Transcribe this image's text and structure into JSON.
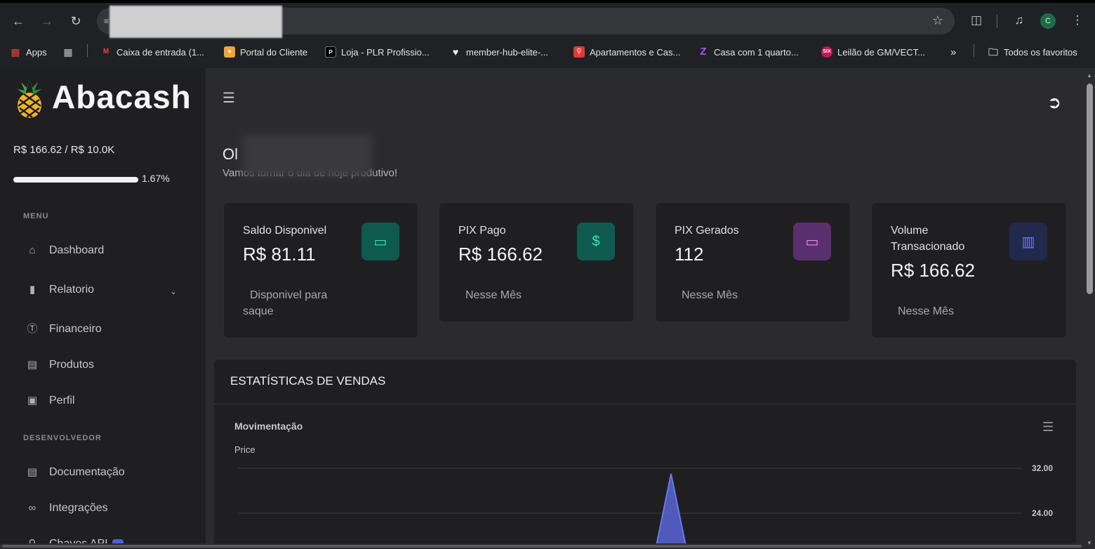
{
  "browser": {
    "bookmarks": [
      {
        "label": "Apps",
        "color": "#e8453c"
      },
      {
        "label": "",
        "color": "#5f6368"
      },
      {
        "label": "Caixa de entrada (1...",
        "color": "#ea4335"
      },
      {
        "label": "Portal do Cliente",
        "color": "#f2a33a"
      },
      {
        "label": "Loja - PLR Profissio...",
        "color": "#000000"
      },
      {
        "label": "member-hub-elite-...",
        "color": "#ffffff"
      },
      {
        "label": "Apartamentos e Cas...",
        "color": "#e53935"
      },
      {
        "label": "Casa com 1 quarto...",
        "color": "#7b3fe4"
      },
      {
        "label": "Leilão de GM/VECT...",
        "color": "#c2185b"
      }
    ],
    "more_bookmarks": "»",
    "all_favorites": "Todos os favoritos",
    "avatar_letter": "C"
  },
  "sidebar": {
    "brand": "Abacash",
    "balance_text": "R$ 166.62 / R$ 10.0K",
    "progress_label": "1.67%",
    "progress_fraction": 0.0167,
    "sections": [
      {
        "label": "MENU"
      },
      {
        "label": "DESENVOLVEDOR"
      }
    ],
    "items": [
      {
        "label": "Dashboard",
        "icon": "home-icon"
      },
      {
        "label": "Relatorio",
        "icon": "chart-icon"
      },
      {
        "label": "Financeiro",
        "icon": "dollar-icon"
      },
      {
        "label": "Produtos",
        "icon": "product-icon"
      },
      {
        "label": "Perfil",
        "icon": "profile-icon"
      },
      {
        "label": "Documentação",
        "icon": "document-icon"
      },
      {
        "label": "Integrações",
        "icon": "integration-icon"
      },
      {
        "label": "Chaves API",
        "icon": "key-icon"
      }
    ]
  },
  "main": {
    "greeting": "Ol",
    "greeting_sub": "Vamos tornar o dia de hoje produtivo!",
    "cards": [
      {
        "title": "Saldo Disponivel",
        "value": "R$ 81.11",
        "sub": "Disponivel para saque",
        "icon": "wallet-icon",
        "icon_bg": "#0f5a4e",
        "icon_color": "#2ee8b6"
      },
      {
        "title": "PIX Pago",
        "value": "R$ 166.62",
        "sub": "Nesse Mês",
        "icon": "dollar-icon",
        "icon_bg": "#0f5a4e",
        "icon_color": "#2ee8b6"
      },
      {
        "title": "PIX Gerados",
        "value": "112",
        "sub": "Nesse Mês",
        "icon": "wallet-icon",
        "icon_bg": "#5a2f6e",
        "icon_color": "#e58bf5"
      },
      {
        "title": "Volume Transacionado",
        "value": "R$ 166.62",
        "sub": "Nesse Mês",
        "icon": "bar-chart-icon",
        "icon_bg": "#23284d",
        "icon_color": "#6f7de8"
      }
    ],
    "stats_title": "ESTATÍSTICAS DE VENDAS",
    "chart_title": "Movimentação",
    "chart_ylabel": "Price"
  },
  "chart_data": {
    "type": "area",
    "title": "Movimentação",
    "ylabel": "Price",
    "xlabel": "",
    "y_ticks": [
      "32.00",
      "24.00"
    ],
    "ylim_visible": [
      20,
      34
    ],
    "series": [
      {
        "values": [
          0,
          0,
          0,
          0,
          0,
          0,
          0,
          0,
          31,
          0,
          0,
          0,
          0,
          0,
          0,
          0,
          0,
          0,
          0,
          0
        ],
        "color": "#5865d6"
      }
    ],
    "grid": true
  }
}
